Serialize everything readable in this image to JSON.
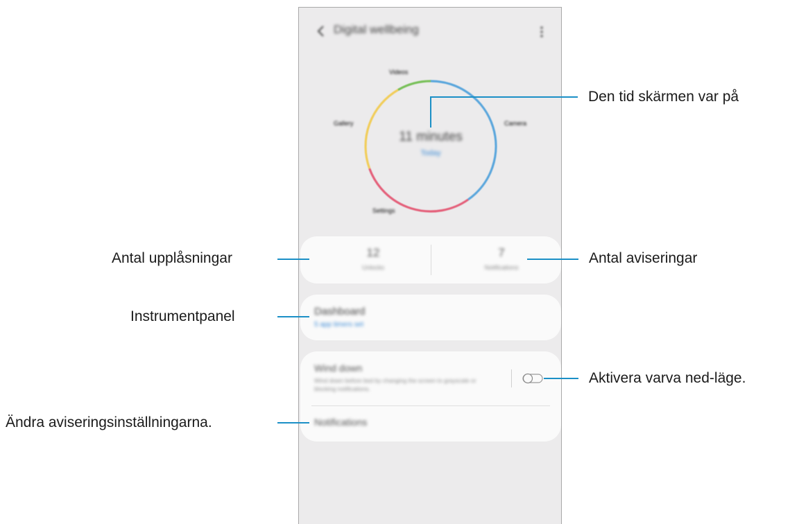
{
  "app": {
    "title": "Digital wellbeing",
    "icons": {
      "back": "chevron-left-icon",
      "more": "more-vertical-icon"
    }
  },
  "usage_ring": {
    "total": "11 minutes",
    "period": "Today",
    "labels": [
      "Videos",
      "Camera",
      "Gallery",
      "Settings"
    ],
    "colors": {
      "green": "#79c05a",
      "blue": "#5aa6dc",
      "red": "#e4607a",
      "yellow": "#f1cd5b"
    }
  },
  "stats": {
    "unlocks_value": "12",
    "unlocks_label": "Unlocks",
    "notifications_value": "7",
    "notifications_label": "Notifications"
  },
  "dashboard": {
    "title": "Dashboard",
    "subtitle": "5 app timers set"
  },
  "wind_down": {
    "title": "Wind down",
    "description": "Wind down before bed by changing the screen to grayscale or blocking notifications.",
    "toggle_on": false
  },
  "notifications": {
    "title": "Notifications"
  },
  "callouts": {
    "screen_time": "Den tid skärmen var på",
    "unlocks": "Antal upplåsningar",
    "notifications_count": "Antal aviseringar",
    "dashboard": "Instrumentpanel",
    "wind_down": "Aktivera varva ned-läge.",
    "notification_settings": "Ändra aviseringsinställningarna."
  },
  "colors": {
    "leader": "#1a8fc6",
    "accent": "#3a8ad6",
    "screen_bg": "#ecebec"
  }
}
